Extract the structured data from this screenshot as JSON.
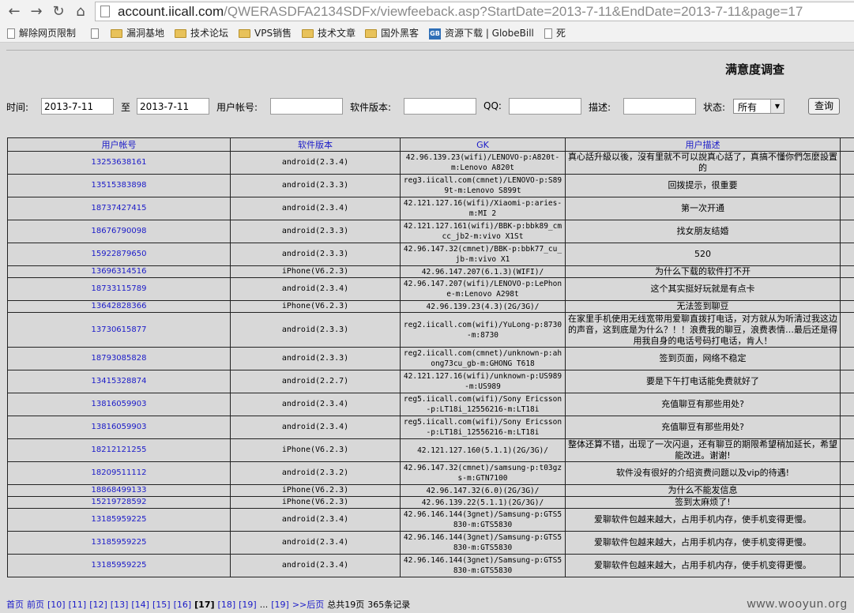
{
  "browser": {
    "url_host": "account.iicall.com",
    "url_path": "/QWERASDFA2134SDFx/viewfeeback.asp?StartDate=2013-7-11&EndDate=2013-7-11&page=17",
    "bookmarks": [
      {
        "label": "解除网页限制",
        "icon": "page-icon"
      },
      {
        "label": "漏洞基地",
        "icon": "folder-icon"
      },
      {
        "label": "技术论坛",
        "icon": "folder-icon"
      },
      {
        "label": "VPS销售",
        "icon": "folder-icon"
      },
      {
        "label": "技术文章",
        "icon": "folder-icon"
      },
      {
        "label": "国外黑客",
        "icon": "folder-icon"
      },
      {
        "label": "资源下载 | GlobeBill",
        "icon": "globebill-icon"
      },
      {
        "label": "死",
        "icon": "page-icon"
      }
    ]
  },
  "page": {
    "title": "满意度调查",
    "filters": {
      "time_label": "时间:",
      "start_date": "2013-7-11",
      "to_label": "至",
      "end_date": "2013-7-11",
      "account_label": "用户帐号:",
      "version_label": "软件版本:",
      "qq_label": "QQ:",
      "desc_label": "描述:",
      "status_label": "状态:",
      "status_value": "所有",
      "search_button": "查询"
    },
    "table": {
      "headers": [
        "用户帐号",
        "软件版本",
        "GK",
        "用户描述"
      ],
      "rows": [
        {
          "h": 30,
          "account": "13253638161",
          "version": "android(2.3.4)",
          "gk": "42.96.139.23(wifi)/LENOVO-p:A820t-m:Lenovo A820t",
          "desc": "真心話升級以後，沒有里就不可以說真心話了，真搞不懂你們怎麼設置的"
        },
        {
          "h": 30,
          "account": "13515383898",
          "version": "android(2.3.3)",
          "gk": "reg3.iicall.com(cmnet)/LENOVO-p:S899t-m:Lenovo S899t",
          "desc": "回拨提示，很重要"
        },
        {
          "h": 30,
          "account": "18737427415",
          "version": "android(2.3.4)",
          "gk": "42.121.127.16(wifi)/Xiaomi-p:aries-m:MI 2",
          "desc": "第一次开通"
        },
        {
          "h": 30,
          "account": "18676790098",
          "version": "android(2.3.3)",
          "gk": "42.121.127.161(wifi)/BBK-p:bbk89_cmcc_jb2-m:vivo X1St",
          "desc": "找女朋友结婚"
        },
        {
          "h": 30,
          "account": "15922879650",
          "version": "android(2.3.3)",
          "gk": "42.96.147.32(cmnet)/BBK-p:bbk77_cu_jb-m:vivo X1",
          "desc": "520"
        },
        {
          "h": 16,
          "account": "13696314516",
          "version": "iPhone(V6.2.3)",
          "gk": "42.96.147.207(6.1.3)(WIFI)/",
          "desc": "为什么下载的软件打不开"
        },
        {
          "h": 30,
          "account": "18733115789",
          "version": "android(2.3.4)",
          "gk": "42.96.147.207(wifi)/LENOVO-p:LePhone-m:Lenovo A298t",
          "desc": "这个其实挺好玩就是有点卡"
        },
        {
          "h": 16,
          "account": "13642828366",
          "version": "iPhone(V6.2.3)",
          "gk": "42.96.139.23(4.3)(2G/3G)/",
          "desc": "无法签到聊豆"
        },
        {
          "h": 45,
          "account": "13730615877",
          "version": "android(2.3.3)",
          "gk": "reg2.iicall.com(wifi)/YuLong-p:8730-m:8730",
          "desc": "在家里手机使用无线宽带用爱聊直拨打电话，对方就从为听清过我这边的声音，这到底是为什么？！！浪费我的聊豆，浪费表情…最后还是得用我自身的电话号码打电话，肯人！"
        },
        {
          "h": 30,
          "account": "18793085828",
          "version": "android(2.3.3)",
          "gk": "reg2.iicall.com(cmnet)/unknown-p:ahong73cu_gb-m:GHONG T618",
          "desc": "签到页面，网络不稳定"
        },
        {
          "h": 30,
          "account": "13415328874",
          "version": "android(2.2.7)",
          "gk": "42.121.127.16(wifi)/unknown-p:US989-m:US989",
          "desc": "要是下午打电话能免费就好了"
        },
        {
          "h": 30,
          "account": "13816059903",
          "version": "android(2.3.4)",
          "gk": "reg5.iicall.com(wifi)/Sony Ericsson-p:LT18i_12556216-m:LT18i",
          "desc": "充值聊豆有那些用处?"
        },
        {
          "h": 30,
          "account": "13816059903",
          "version": "android(2.3.4)",
          "gk": "reg5.iicall.com(wifi)/Sony Ericsson-p:LT18i_12556216-m:LT18i",
          "desc": "充值聊豆有那些用处?"
        },
        {
          "h": 30,
          "account": "18212121255",
          "version": "iPhone(V6.2.3)",
          "gk": "42.121.127.160(5.1.1)(2G/3G)/",
          "desc": "整体还算不错，出现了一次闪退，还有聊豆的期限希望稍加延长，希望能改进。谢谢!"
        },
        {
          "h": 30,
          "account": "18209511112",
          "version": "android(2.3.2)",
          "gk": "42.96.147.32(cmnet)/samsung-p:t03gzs-m:GTN7100",
          "desc": "软件没有很好的介绍资费问题以及vip的待遇!"
        },
        {
          "h": 16,
          "account": "18868499133",
          "version": "iPhone(V6.2.3)",
          "gk": "42.96.147.32(6.0)(2G/3G)/",
          "desc": "为什么不能发信息"
        },
        {
          "h": 16,
          "account": "15219728592",
          "version": "iPhone(V6.2.3)",
          "gk": "42.96.139.22(5.1.1)(2G/3G)/",
          "desc": "签到太麻烦了!"
        },
        {
          "h": 30,
          "account": "13185959225",
          "version": "android(2.3.4)",
          "gk": "42.96.146.144(3gnet)/Samsung-p:GTS5830-m:GTS5830",
          "desc": "爱聊软件包越来越大，占用手机内存，使手机变得更慢。"
        },
        {
          "h": 30,
          "account": "13185959225",
          "version": "android(2.3.4)",
          "gk": "42.96.146.144(3gnet)/Samsung-p:GTS5830-m:GTS5830",
          "desc": "爱聊软件包越来越大，占用手机内存，使手机变得更慢。"
        },
        {
          "h": 30,
          "account": "13185959225",
          "version": "android(2.3.4)",
          "gk": "42.96.146.144(3gnet)/Samsung-p:GTS5830-m:GTS5830",
          "desc": "爱聊软件包越来越大，占用手机内存，使手机变得更慢。"
        }
      ]
    },
    "pager": {
      "items": [
        {
          "t": "首页",
          "k": "lnk"
        },
        {
          "t": "前页",
          "k": "lnk"
        },
        {
          "t": "[10]",
          "k": "lnk"
        },
        {
          "t": "[11]",
          "k": "lnk"
        },
        {
          "t": "[12]",
          "k": "lnk"
        },
        {
          "t": "[13]",
          "k": "lnk"
        },
        {
          "t": "[14]",
          "k": "lnk"
        },
        {
          "t": "[15]",
          "k": "lnk"
        },
        {
          "t": "[16]",
          "k": "lnk"
        },
        {
          "t": "[17]",
          "k": "cur"
        },
        {
          "t": "[18]",
          "k": "lnk"
        },
        {
          "t": "[19]",
          "k": "lnk"
        },
        {
          "t": "...",
          "k": "txt"
        },
        {
          "t": "[19]",
          "k": "lnk"
        },
        {
          "t": ">>后页",
          "k": "lnk"
        },
        {
          "t": "总共19页",
          "k": "txt"
        },
        {
          "t": "365条记录",
          "k": "txt"
        }
      ]
    },
    "watermark": "www.wooyun.org"
  }
}
